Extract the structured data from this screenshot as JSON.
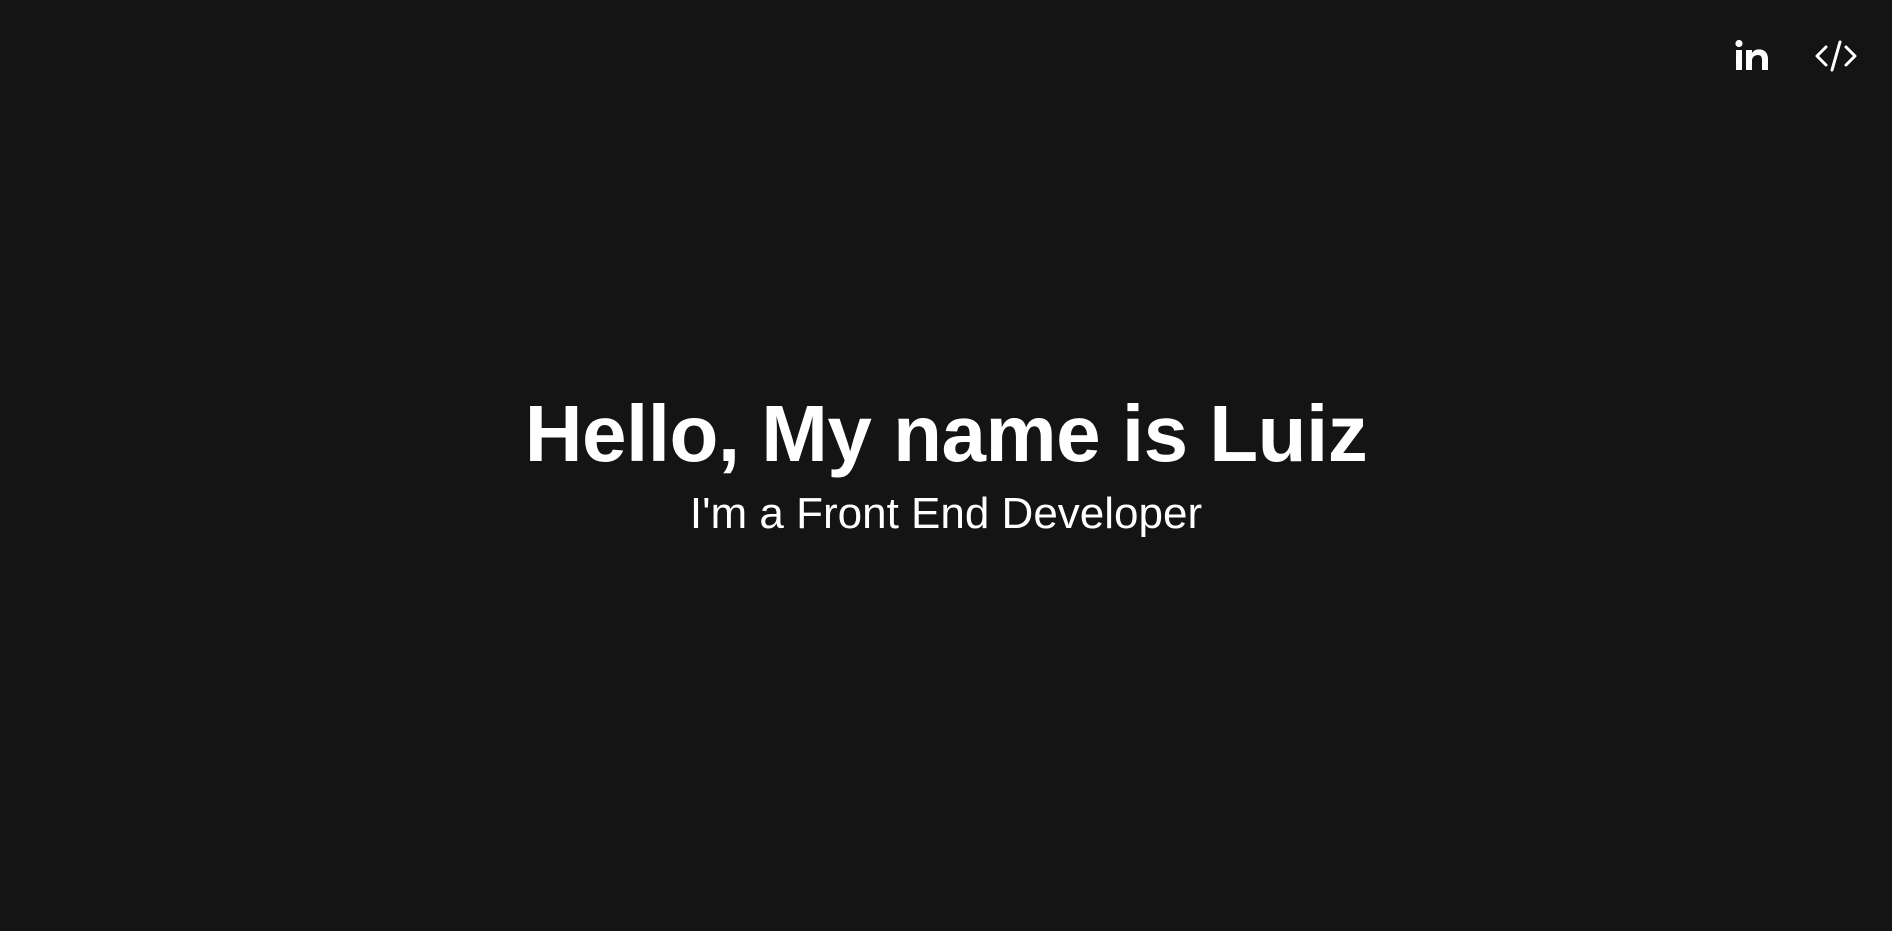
{
  "page": {
    "background_color": "#141414",
    "text_color": "#ffffff"
  },
  "nav": {
    "links": [
      {
        "icon": "linkedin-icon",
        "label": "in"
      },
      {
        "icon": "code-icon"
      }
    ]
  },
  "hero": {
    "title": "Hello, My name is Luiz",
    "subtitle": "I'm a Front End Developer"
  }
}
